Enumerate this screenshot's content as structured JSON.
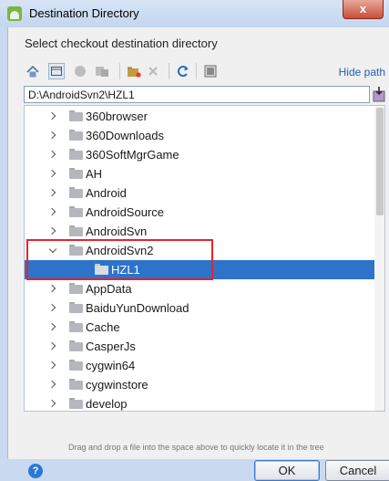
{
  "window": {
    "title": "Destination Directory",
    "close_glyph": "x"
  },
  "prompt": "Select checkout destination directory",
  "toolbar": {
    "icons": [
      "home-icon",
      "desktop-icon",
      "android-icon",
      "module-icon",
      "new-folder-icon",
      "delete-icon",
      "refresh-icon",
      "toggle-hidden-files-icon"
    ],
    "hide_path_label": "Hide path"
  },
  "path": {
    "value": "D:\\AndroidSvn2\\HZL1"
  },
  "tree": {
    "items": [
      {
        "label": "360browser",
        "depth": 0,
        "expanded": false,
        "selected": false
      },
      {
        "label": "360Downloads",
        "depth": 0,
        "expanded": false,
        "selected": false
      },
      {
        "label": "360SoftMgrGame",
        "depth": 0,
        "expanded": false,
        "selected": false
      },
      {
        "label": "AH",
        "depth": 0,
        "expanded": false,
        "selected": false
      },
      {
        "label": "Android",
        "depth": 0,
        "expanded": false,
        "selected": false
      },
      {
        "label": "AndroidSource",
        "depth": 0,
        "expanded": false,
        "selected": false
      },
      {
        "label": "AndroidSvn",
        "depth": 0,
        "expanded": false,
        "selected": false
      },
      {
        "label": "AndroidSvn2",
        "depth": 0,
        "expanded": true,
        "selected": false
      },
      {
        "label": "HZL1",
        "depth": 1,
        "expanded": false,
        "selected": true
      },
      {
        "label": "AppData",
        "depth": 0,
        "expanded": false,
        "selected": false
      },
      {
        "label": "BaiduYunDownload",
        "depth": 0,
        "expanded": false,
        "selected": false
      },
      {
        "label": "Cache",
        "depth": 0,
        "expanded": false,
        "selected": false
      },
      {
        "label": "CasperJs",
        "depth": 0,
        "expanded": false,
        "selected": false
      },
      {
        "label": "cygwin64",
        "depth": 0,
        "expanded": false,
        "selected": false
      },
      {
        "label": "cygwinstore",
        "depth": 0,
        "expanded": false,
        "selected": false
      },
      {
        "label": "develop",
        "depth": 0,
        "expanded": false,
        "selected": false
      }
    ]
  },
  "hint": "Drag and drop a file into the space above to quickly locate it in the tree",
  "buttons": {
    "help_glyph": "?",
    "ok": "OK",
    "cancel": "Cancel"
  },
  "colors": {
    "selection": "#2d73c9",
    "annotation_box": "#e0262c",
    "link": "#1d5fb8"
  }
}
